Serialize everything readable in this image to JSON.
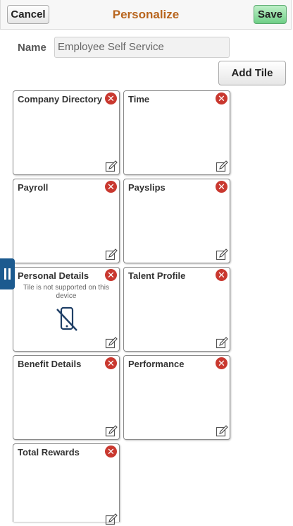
{
  "header": {
    "title": "Personalize",
    "cancel_label": "Cancel",
    "save_label": "Save"
  },
  "name_field": {
    "label": "Name",
    "value": "Employee Self Service"
  },
  "add_tile_label": "Add Tile",
  "tiles": [
    {
      "title": "Company Directory"
    },
    {
      "title": "Time"
    },
    {
      "title": "Payroll"
    },
    {
      "title": "Payslips"
    },
    {
      "title": "Personal Details",
      "message": "Tile is not supported on this device"
    },
    {
      "title": "Talent Profile"
    },
    {
      "title": "Benefit Details"
    },
    {
      "title": "Performance"
    },
    {
      "title": "Total Rewards"
    }
  ],
  "colors": {
    "title": "#b8651e",
    "save_button": "#6fcf87",
    "remove_icon": "#c9382f",
    "side_tab": "#1c5a8f"
  },
  "icons": {
    "remove": "close-circle-icon",
    "edit": "edit-icon",
    "unsupported": "mobile-not-supported-icon",
    "side_tab": "pause-icon"
  }
}
